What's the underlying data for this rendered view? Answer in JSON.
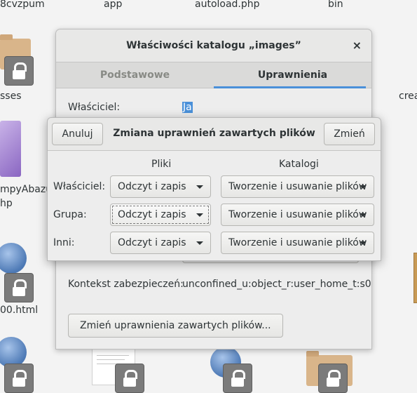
{
  "desktop": {
    "top_labels": [
      "8cvzpum",
      "app",
      "autoload.php",
      "bin"
    ],
    "left_labels": [
      "sses",
      "mpyAbazur",
      "hp",
      "00.html"
    ],
    "right_label": "crea"
  },
  "properties_window": {
    "title": "Właściwości katalogu „images”",
    "close_icon": "×",
    "tabs": [
      {
        "label": "Podstawowe",
        "active": false
      },
      {
        "label": "Uprawnienia",
        "active": true
      }
    ],
    "owner_label": "Właściciel:",
    "owner_value": "Ja",
    "security_context_label": "Kontekst zabezpieczeń:",
    "security_context_value": "unconfined_u:object_r:user_home_t:s0",
    "change_contents_button": "Zmień uprawnienia zawartych plików..."
  },
  "dialog": {
    "title": "Zmiana uprawnień zawartych plików",
    "cancel_button": "Anuluj",
    "apply_button": "Zmień",
    "columns": {
      "files": "Pliki",
      "folders": "Katalogi"
    },
    "rows": [
      {
        "label": "Właściciel:",
        "files": "Odczyt i zapis",
        "folders": "Tworzenie i usuwanie plików"
      },
      {
        "label": "Grupa:",
        "files": "Odczyt i zapis",
        "folders": "Tworzenie i usuwanie plików"
      },
      {
        "label": "Inni:",
        "files": "Odczyt i zapis",
        "folders": "Tworzenie i usuwanie plików"
      }
    ]
  }
}
